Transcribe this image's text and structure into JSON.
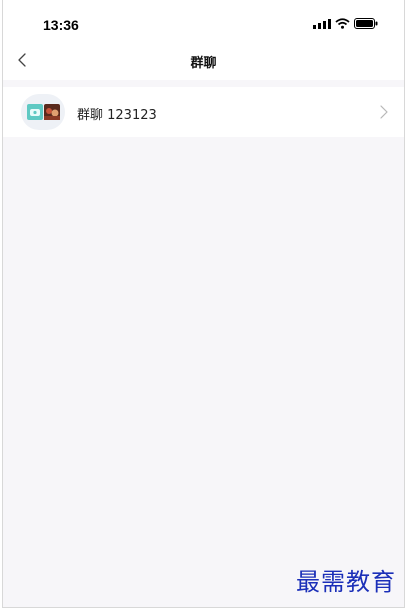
{
  "status_bar": {
    "time": "13:36"
  },
  "nav": {
    "title": "群聊"
  },
  "groups": [
    {
      "name": "群聊 123123"
    }
  ],
  "watermark": "最需教育",
  "colors": {
    "background": "#f7f6f9",
    "surface": "#ffffff",
    "watermark": "#1b2fb8"
  }
}
